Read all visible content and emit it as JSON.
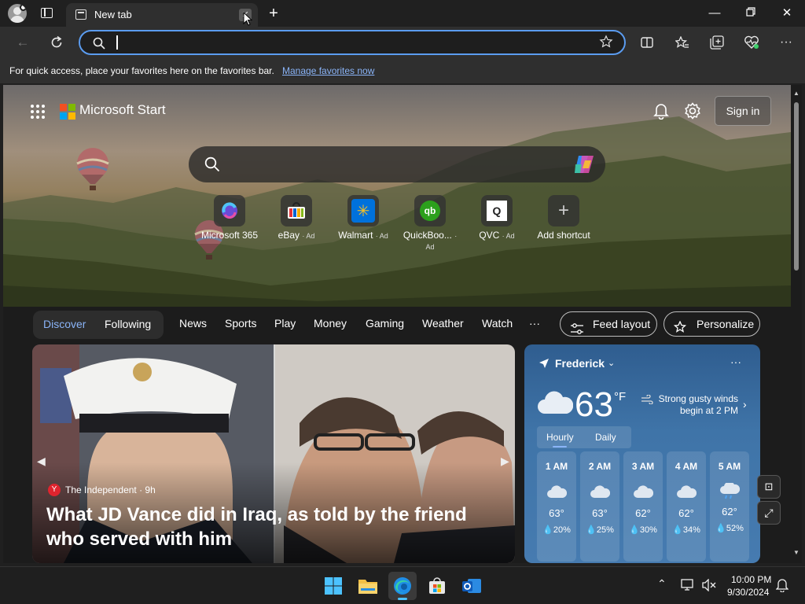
{
  "browser": {
    "tab_title": "New tab",
    "address_value": "",
    "favorites_hint": "For quick access, place your favorites here on the favorites bar.",
    "favorites_link": "Manage favorites now"
  },
  "start": {
    "brand": "Microsoft Start",
    "sign_in": "Sign in",
    "shortcuts": [
      {
        "label": "Microsoft 365",
        "ad": ""
      },
      {
        "label": "eBay",
        "ad": "· Ad"
      },
      {
        "label": "Walmart",
        "ad": "· Ad"
      },
      {
        "label": "QuickBoo...",
        "ad": "· Ad"
      },
      {
        "label": "QVC",
        "ad": "· Ad"
      },
      {
        "label": "Add shortcut",
        "ad": ""
      }
    ],
    "nav": {
      "discover": "Discover",
      "following": "Following",
      "items": [
        "News",
        "Sports",
        "Play",
        "Money",
        "Gaming",
        "Weather",
        "Watch"
      ],
      "more": "···",
      "feed_layout": "Feed layout",
      "personalize": "Personalize"
    },
    "news": {
      "source": "The Independent · 9h",
      "headline": "What JD Vance did in Iraq, as told by the friend who served with him"
    },
    "weather": {
      "location": "Frederick",
      "temp": "63",
      "unit": "°F",
      "alert": "Strong gusty winds begin at 2 PM",
      "tabs": [
        "Hourly",
        "Daily"
      ],
      "hours": [
        {
          "time": "1 AM",
          "temp": "63°",
          "precip": "20%"
        },
        {
          "time": "2 AM",
          "temp": "63°",
          "precip": "25%"
        },
        {
          "time": "3 AM",
          "temp": "62°",
          "precip": "30%"
        },
        {
          "time": "4 AM",
          "temp": "62°",
          "precip": "34%"
        },
        {
          "time": "5 AM",
          "temp": "62°",
          "precip": "52%"
        }
      ]
    }
  },
  "taskbar": {
    "time": "10:00 PM",
    "date": "9/30/2024"
  },
  "colors": {
    "accent": "#5b9cf0",
    "link": "#8ab4f8"
  }
}
